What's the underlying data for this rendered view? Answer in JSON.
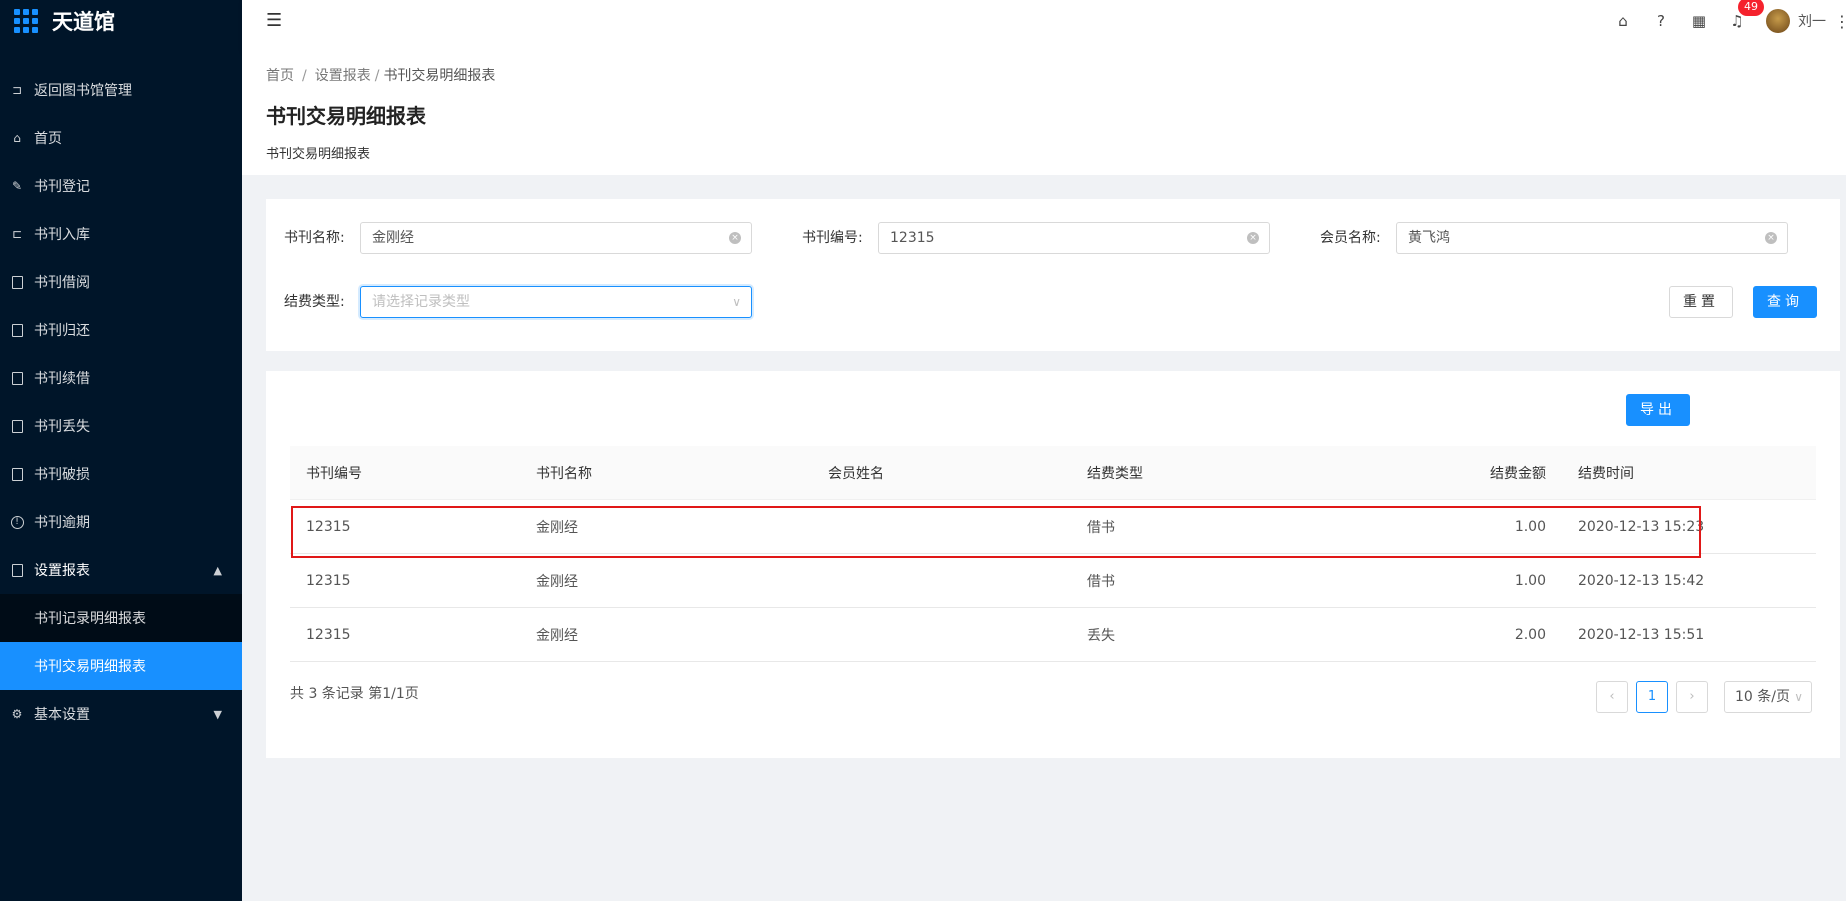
{
  "app": {
    "title": "天道馆"
  },
  "sidebar": {
    "items": [
      {
        "label": "返回图书馆管理",
        "icon": "return-icon"
      },
      {
        "label": "首页",
        "icon": "home-icon"
      },
      {
        "label": "书刊登记",
        "icon": "edit-icon"
      },
      {
        "label": "书刊入库",
        "icon": "import-icon"
      },
      {
        "label": "书刊借阅",
        "icon": "book-icon"
      },
      {
        "label": "书刊归还",
        "icon": "book-icon"
      },
      {
        "label": "书刊续借",
        "icon": "book-icon"
      },
      {
        "label": "书刊丢失",
        "icon": "book-icon"
      },
      {
        "label": "书刊破损",
        "icon": "book-icon"
      },
      {
        "label": "书刊逾期",
        "icon": "info-icon"
      },
      {
        "label": "设置报表",
        "icon": "report-icon"
      },
      {
        "label": "基本设置",
        "icon": "gear-icon"
      }
    ],
    "submenu": [
      "书刊记录明细报表",
      "书刊交易明细报表"
    ]
  },
  "header": {
    "notification_count": "49",
    "user_name": "刘一"
  },
  "breadcrumb": [
    "首页",
    "设置报表",
    "书刊交易明细报表"
  ],
  "page": {
    "title": "书刊交易明细报表",
    "description": "书刊交易明细报表"
  },
  "filters": {
    "book_name_label": "书刊名称:",
    "book_name_value": "金刚经",
    "book_code_label": "书刊编号:",
    "book_code_value": "12315",
    "member_name_label": "会员名称:",
    "member_name_value": "黄飞鸿",
    "fee_type_label": "结费类型:",
    "fee_type_placeholder": "请选择记录类型",
    "reset_label": "重置",
    "search_label": "查询"
  },
  "table": {
    "export_label": "导出",
    "columns": [
      "书刊编号",
      "书刊名称",
      "会员姓名",
      "结费类型",
      "结费金额",
      "结费时间"
    ],
    "rows": [
      [
        "12315",
        "金刚经",
        "",
        "借书",
        "1.00",
        "2020-12-13 15:23"
      ],
      [
        "12315",
        "金刚经",
        "",
        "借书",
        "1.00",
        "2020-12-13 15:42"
      ],
      [
        "12315",
        "金刚经",
        "",
        "丢失",
        "2.00",
        "2020-12-13 15:51"
      ]
    ],
    "summary": "共 3 条记录 第1/1页",
    "current_page": "1",
    "page_size": "10 条/页"
  },
  "colors": {
    "accent": "#1890ff",
    "sidebar_bg": "#001529",
    "highlight_border": "#e01818"
  }
}
